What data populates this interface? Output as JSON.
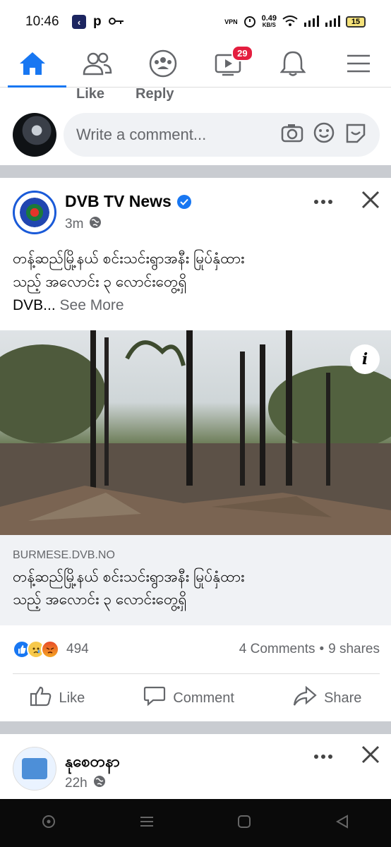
{
  "status_bar": {
    "time": "10:46",
    "net_speed_value": "0.49",
    "net_speed_unit": "KB/S",
    "battery": "15",
    "vpn_label": "VPN"
  },
  "nav": {
    "notifications_badge": "29"
  },
  "previous_comment": {
    "like_label": "Like",
    "reply_label": "Reply"
  },
  "comment_composer": {
    "placeholder": "Write a comment..."
  },
  "post": {
    "page_name": "DVB TV News",
    "time_ago": "3m",
    "text_line1": "တန့်ဆည်မြို့နယ် စင်းသင်းရွာအနီး မြုပ်နှံထား",
    "text_line2": "သည့် အလောင်း ၃ လောင်းတွေ့ရှိ",
    "text_line3": "DVB...",
    "see_more": "See More",
    "info_label": "i",
    "link": {
      "domain": "BURMESE.DVB.NO",
      "title_line1": "တန့်ဆည်မြို့နယ် စင်းသင်းရွာအနီး မြုပ်နှံထား",
      "title_line2": "သည့် အလောင်း ၃ လောင်းတွေ့ရှိ"
    },
    "reactions_count": "494",
    "comments": "4 Comments",
    "dot": "•",
    "shares": "9 shares",
    "actions": {
      "like": "Like",
      "comment": "Comment",
      "share": "Share"
    }
  },
  "next_post": {
    "page_name": "နုစေတနာ",
    "time_ago": "22h"
  },
  "colors": {
    "brand_blue": "#1877f2",
    "badge_red": "#e41e3f",
    "secondary_text": "#65676b",
    "divider": "#c9ccd1"
  }
}
